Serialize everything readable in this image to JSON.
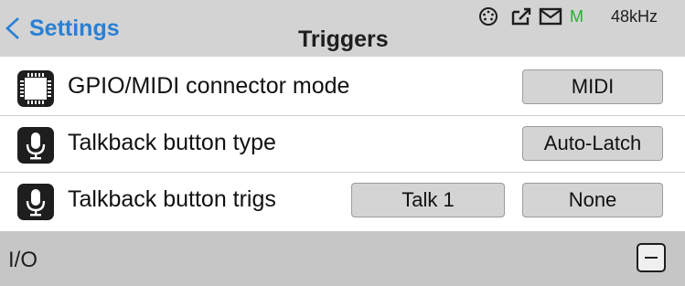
{
  "header": {
    "back_label": "Settings",
    "title": "Triggers",
    "status": {
      "midi_port_icon": "midi-din-icon",
      "usb_icon": "usb-storage-icon",
      "mail_icon": "envelope-icon",
      "meter_letter": "M",
      "sample_rate": "48kHz"
    }
  },
  "rows": [
    {
      "icon": "chip-icon",
      "label": "GPIO/MIDI connector mode",
      "buttons": [
        "MIDI"
      ]
    },
    {
      "icon": "microphone-icon",
      "label": "Talkback button type",
      "buttons": [
        "Auto-Latch"
      ]
    },
    {
      "icon": "microphone-icon",
      "label": "Talkback button trigs",
      "buttons": [
        "Talk 1",
        "None"
      ]
    }
  ],
  "footer": {
    "label": "I/O",
    "collapse_icon": "minus-icon"
  },
  "colors": {
    "accent": "#2a7fd3",
    "status_green": "#21b32e",
    "header_bg": "#d3d3d3",
    "footer_bg": "#c6c6c6"
  }
}
